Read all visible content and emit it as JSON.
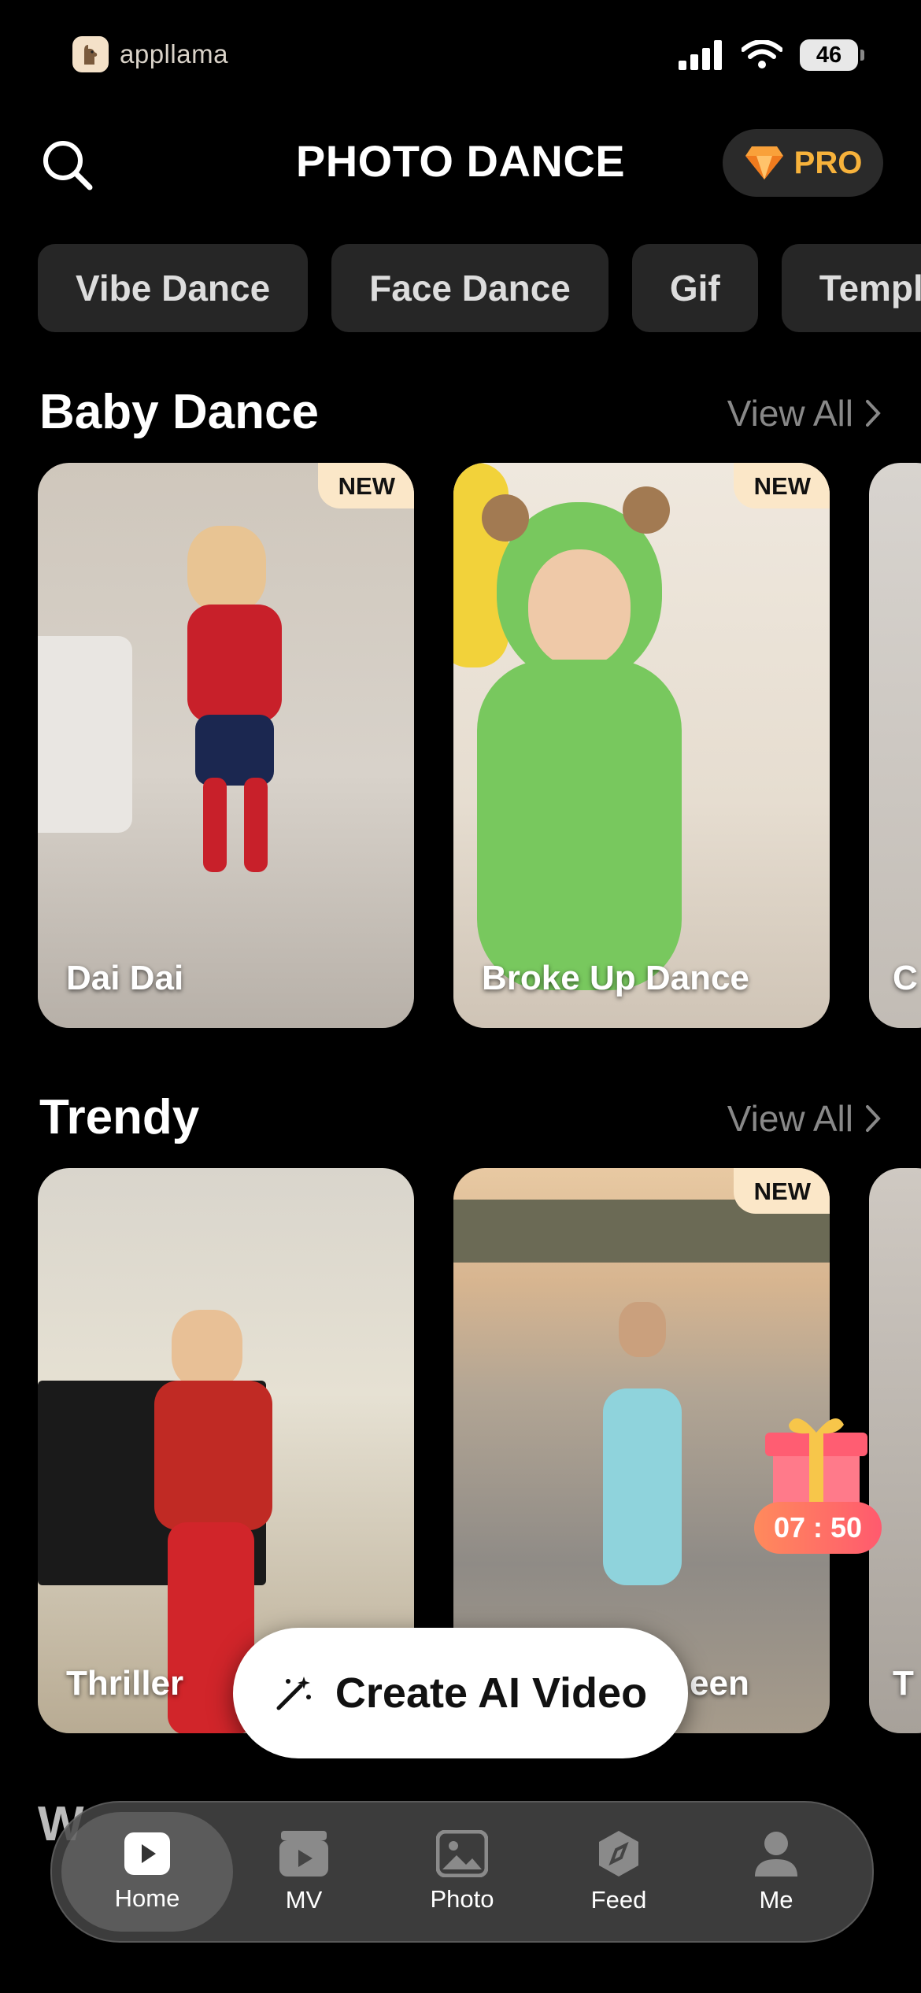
{
  "status_bar": {
    "brand": "appllama",
    "battery": "46"
  },
  "header": {
    "title": "PHOTO DANCE",
    "pro_label": "PRO"
  },
  "chips": [
    "Vibe Dance",
    "Face Dance",
    "Gif",
    "Templ"
  ],
  "sections": [
    {
      "title": "Baby Dance",
      "view_all": "View All",
      "cards": [
        {
          "label": "Dai Dai",
          "badge": "NEW"
        },
        {
          "label": "Broke Up Dance",
          "badge": "NEW"
        },
        {
          "label": "C"
        }
      ]
    },
    {
      "title": "Trendy",
      "view_all": "View All",
      "cards": [
        {
          "label": "Thriller"
        },
        {
          "label": "een",
          "badge": "NEW"
        },
        {
          "label": "T"
        }
      ]
    }
  ],
  "promo_timer": "07 : 50",
  "create_button": "Create AI Video",
  "partial_section_title": "W",
  "bottom_nav": [
    {
      "label": "Home",
      "icon": "play-icon",
      "active": true
    },
    {
      "label": "MV",
      "icon": "clapper-icon"
    },
    {
      "label": "Photo",
      "icon": "image-icon"
    },
    {
      "label": "Feed",
      "icon": "compass-icon"
    },
    {
      "label": "Me",
      "icon": "person-icon"
    }
  ],
  "colors": {
    "background": "#000000",
    "chip_bg": "#262626",
    "pro_accent": "#f7b23b",
    "new_badge": "#fbe7c8",
    "view_all": "#888888"
  }
}
